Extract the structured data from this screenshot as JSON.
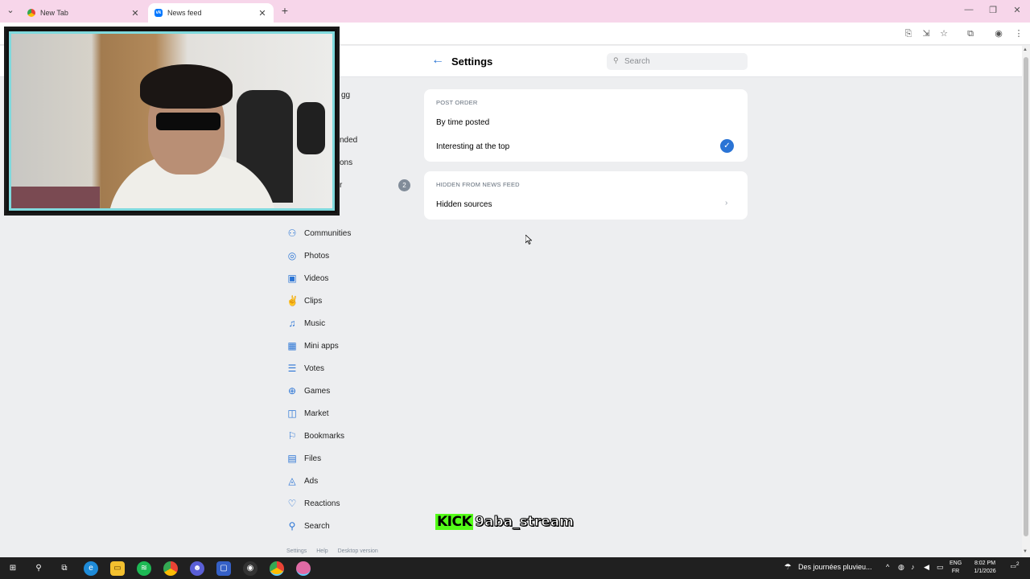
{
  "browser": {
    "tabs": [
      {
        "label": "New Tab",
        "icon": "chrome-icon"
      },
      {
        "label": "News feed",
        "icon": "vk-icon"
      }
    ],
    "tab_close": "✕",
    "new_tab": "+",
    "window_controls": {
      "minimize": "—",
      "maximize": "❐",
      "close": "✕"
    }
  },
  "header": {
    "title": "Settings",
    "search_placeholder": "Search",
    "back_glyph": "←"
  },
  "left_menu": {
    "partial_items": [
      "gg",
      "nded",
      "ons",
      "r"
    ],
    "badge": "2",
    "items": [
      {
        "label": "Communities",
        "icon": "communities-icon",
        "glyph": "⚇"
      },
      {
        "label": "Photos",
        "icon": "photos-icon",
        "glyph": "◎"
      },
      {
        "label": "Videos",
        "icon": "videos-icon",
        "glyph": "▣"
      },
      {
        "label": "Clips",
        "icon": "clips-icon",
        "glyph": "✌"
      },
      {
        "label": "Music",
        "icon": "music-icon",
        "glyph": "♫"
      },
      {
        "label": "Mini apps",
        "icon": "mini-apps-icon",
        "glyph": "▦"
      },
      {
        "label": "Votes",
        "icon": "votes-icon",
        "glyph": "☰"
      },
      {
        "label": "Games",
        "icon": "games-icon",
        "glyph": "⊕"
      },
      {
        "label": "Market",
        "icon": "market-icon",
        "glyph": "◫"
      },
      {
        "label": "Bookmarks",
        "icon": "bookmarks-icon",
        "glyph": "⚐"
      },
      {
        "label": "Files",
        "icon": "files-icon",
        "glyph": "▤"
      },
      {
        "label": "Ads",
        "icon": "ads-icon",
        "glyph": "◬"
      },
      {
        "label": "Reactions",
        "icon": "reactions-icon",
        "glyph": "♡"
      },
      {
        "label": "Search",
        "icon": "search-icon",
        "glyph": "⚲"
      }
    ],
    "footer": [
      "Settings",
      "Help",
      "Desktop version"
    ]
  },
  "post_order": {
    "heading": "POST ORDER",
    "options": [
      {
        "label": "By time posted",
        "selected": false
      },
      {
        "label": "Interesting at the top",
        "selected": true
      }
    ],
    "check_glyph": "✓"
  },
  "hidden": {
    "heading": "HIDDEN FROM NEWS FEED",
    "row_label": "Hidden sources",
    "chevron": "›"
  },
  "watermark": {
    "kick": "KICK",
    "name": "9aba_stream"
  },
  "taskbar": {
    "weather": "Des journées pluvieu...",
    "lang_top": "ENG",
    "lang_bottom": "FR",
    "time": "8:02 PM",
    "date": "1/1/2026",
    "notifications": "2",
    "tray_chevron": "^"
  },
  "colors": {
    "accent": "#2a74d5",
    "tab_strip": "#f7d6ea",
    "page_bg": "#edeef0",
    "kick_green": "#53fc18",
    "webcam_border": "#7fd9dd"
  }
}
